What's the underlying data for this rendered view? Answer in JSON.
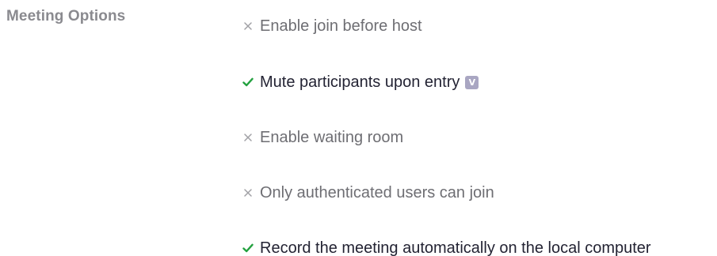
{
  "section": {
    "label": "Meeting Options"
  },
  "colors": {
    "check": "#23a13f",
    "cross": "#a0a0a5",
    "badge": "#a9a6c2"
  },
  "options": [
    {
      "label": "Enable join before host",
      "enabled": false,
      "icon": "cross-icon"
    },
    {
      "label": "Mute participants upon entry",
      "enabled": true,
      "icon": "check-icon",
      "badge": "V",
      "badge_icon": "lock-badge-icon"
    },
    {
      "label": "Enable waiting room",
      "enabled": false,
      "icon": "cross-icon"
    },
    {
      "label": "Only authenticated users can join",
      "enabled": false,
      "icon": "cross-icon"
    },
    {
      "label": "Record the meeting automatically on the local computer",
      "enabled": true,
      "icon": "check-icon"
    }
  ]
}
